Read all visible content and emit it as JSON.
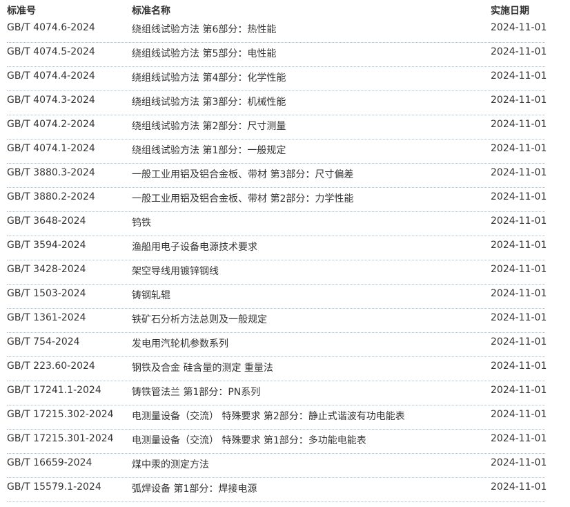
{
  "header": {
    "code": "标准号",
    "name": "标准名称",
    "date": "实施日期"
  },
  "rows": [
    {
      "code": "GB/T 4074.6-2024",
      "name": "绕组线试验方法 第6部分：热性能",
      "date": "2024-11-01"
    },
    {
      "code": "GB/T 4074.5-2024",
      "name": "绕组线试验方法 第5部分：电性能",
      "date": "2024-11-01"
    },
    {
      "code": "GB/T 4074.4-2024",
      "name": "绕组线试验方法 第4部分：化学性能",
      "date": "2024-11-01"
    },
    {
      "code": "GB/T 4074.3-2024",
      "name": "绕组线试验方法 第3部分：机械性能",
      "date": "2024-11-01"
    },
    {
      "code": "GB/T 4074.2-2024",
      "name": "绕组线试验方法 第2部分：尺寸测量",
      "date": "2024-11-01"
    },
    {
      "code": "GB/T 4074.1-2024",
      "name": "绕组线试验方法 第1部分：一般规定",
      "date": "2024-11-01"
    },
    {
      "code": "GB/T 3880.3-2024",
      "name": "一般工业用铝及铝合金板、带材 第3部分：尺寸偏差",
      "date": "2024-11-01"
    },
    {
      "code": "GB/T 3880.2-2024",
      "name": "一般工业用铝及铝合金板、带材 第2部分：力学性能",
      "date": "2024-11-01"
    },
    {
      "code": "GB/T 3648-2024",
      "name": "钨铁",
      "date": "2024-11-01"
    },
    {
      "code": "GB/T 3594-2024",
      "name": "渔船用电子设备电源技术要求",
      "date": "2024-11-01"
    },
    {
      "code": "GB/T 3428-2024",
      "name": "架空导线用镀锌钢线",
      "date": "2024-11-01"
    },
    {
      "code": "GB/T 1503-2024",
      "name": "铸钢轧辊",
      "date": "2024-11-01"
    },
    {
      "code": "GB/T 1361-2024",
      "name": "铁矿石分析方法总则及一般规定",
      "date": "2024-11-01"
    },
    {
      "code": "GB/T 754-2024",
      "name": "发电用汽轮机参数系列",
      "date": "2024-11-01"
    },
    {
      "code": "GB/T 223.60-2024",
      "name": "钢铁及合金 硅含量的测定 重量法",
      "date": "2024-11-01"
    },
    {
      "code": "GB/T 17241.1-2024",
      "name": "铸铁管法兰 第1部分：PN系列",
      "date": "2024-11-01"
    },
    {
      "code": "GB/T 17215.302-2024",
      "name": "电测量设备（交流） 特殊要求 第2部分：静止式谐波有功电能表",
      "date": "2024-11-01"
    },
    {
      "code": "GB/T 17215.301-2024",
      "name": "电测量设备（交流） 特殊要求 第1部分：多功能电能表",
      "date": "2024-11-01"
    },
    {
      "code": "GB/T 16659-2024",
      "name": "煤中汞的测定方法",
      "date": "2024-11-01"
    },
    {
      "code": "GB/T 15579.1-2024",
      "name": "弧焊设备 第1部分：焊接电源",
      "date": "2024-11-01"
    }
  ]
}
